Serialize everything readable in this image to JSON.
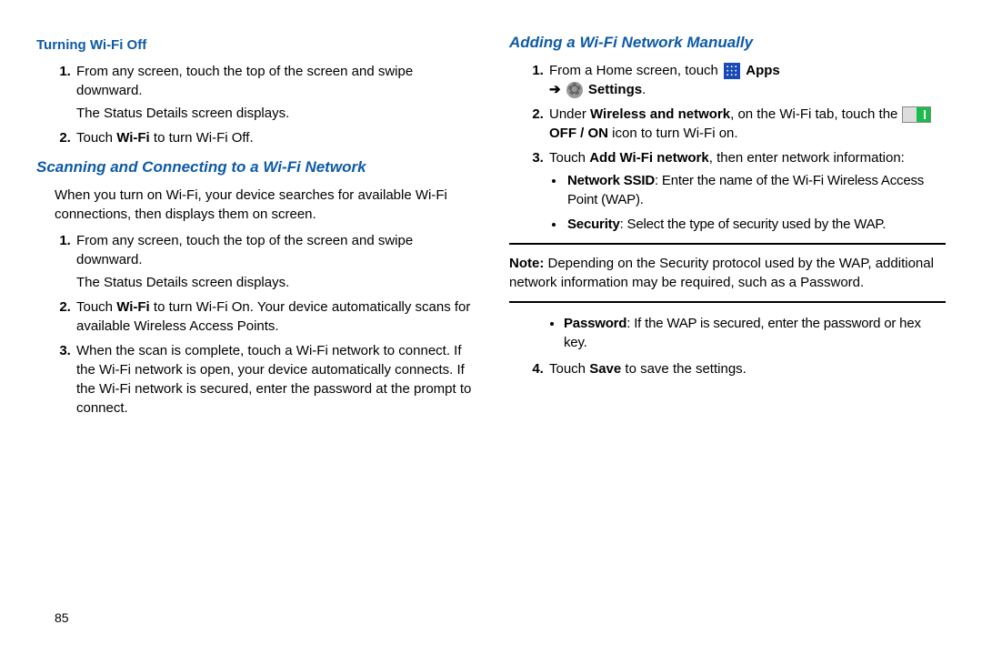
{
  "pageNumber": "85",
  "left": {
    "h1": "Turning Wi-Fi Off",
    "s1_li1_a": "From any screen, touch the top of the screen and swipe downward.",
    "s1_li1_b": "The Status Details screen displays.",
    "s1_li2_a": "Touch ",
    "s1_li2_b": "Wi-Fi",
    "s1_li2_c": " to turn Wi-Fi Off.",
    "h2": "Scanning and Connecting to a Wi-Fi Network",
    "s2_intro": "When you turn on Wi-Fi, your device searches for available Wi-Fi connections, then displays them on screen.",
    "s2_li1_a": "From any screen, touch the top of the screen and swipe downward.",
    "s2_li1_b": "The Status Details screen displays.",
    "s2_li2_a": "Touch ",
    "s2_li2_b": "Wi-Fi",
    "s2_li2_c": " to turn Wi-Fi On. Your device automatically scans for available Wireless Access Points.",
    "s2_li3": "When the scan is complete, touch a Wi-Fi network to connect. If the Wi-Fi network is open, your device automatically connects. If the Wi-Fi network is secured, enter the password at the prompt to connect."
  },
  "right": {
    "h1": "Adding a Wi-Fi Network Manually",
    "r_li1_a": "From a Home screen, touch ",
    "r_li1_apps": " Apps",
    "r_li1_arrow": "➔ ",
    "r_li1_settings": " Settings",
    "r_li1_dot": ".",
    "r_li2_a": "Under ",
    "r_li2_b": "Wireless and network",
    "r_li2_c": ", on the Wi-Fi tab, touch the ",
    "r_li2_d": " OFF / ON",
    "r_li2_e": " icon to turn Wi-Fi on.",
    "r_li3_a": "Touch ",
    "r_li3_b": "Add Wi-Fi network",
    "r_li3_c": ", then enter network information:",
    "b1_a": "Network SSID",
    "b1_b": ": Enter the name of the Wi-Fi Wireless Access Point (WAP).",
    "b2_a": "Security",
    "b2_b": ": Select the type of security used by the WAP.",
    "note_a": "Note: ",
    "note_b": "Depending on the Security protocol used by the WAP, additional network information may be required, such as a Password.",
    "b3_a": "Password",
    "b3_b": ": If the WAP is secured, enter the password or hex key.",
    "r_li4_a": "Touch ",
    "r_li4_b": "Save",
    "r_li4_c": " to save the settings."
  }
}
